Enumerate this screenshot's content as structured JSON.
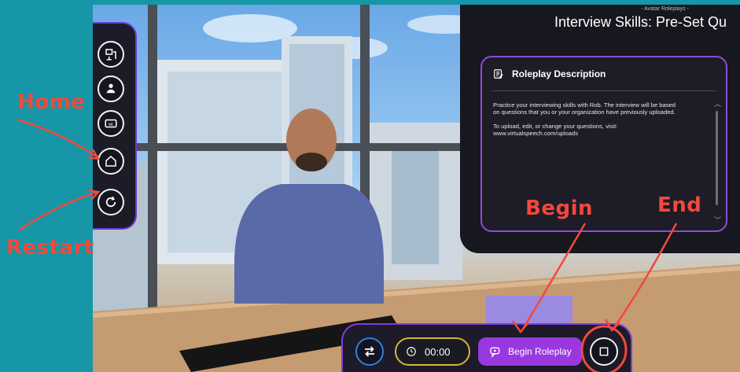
{
  "sidebar": {
    "buttons": [
      {
        "name": "presenter-mode-icon"
      },
      {
        "name": "avatar-icon"
      },
      {
        "name": "closed-captions-icon",
        "text": "cc"
      },
      {
        "name": "home-icon"
      },
      {
        "name": "restart-icon"
      }
    ]
  },
  "annotations": {
    "home": "Home",
    "restart": "Restart",
    "begin": "Begin",
    "end": "End",
    "color": "#f2483d"
  },
  "panel": {
    "kicker": "- Avatar Roleplays -",
    "title": "Interview Skills: Pre-Set Qu",
    "description_heading": "Roleplay Description",
    "description_paragraphs": [
      "Practice your interviewing skills with Rob. The interview will be based on questions that you or your organization have previously uploaded.",
      "To upload, edit, or change your questions, visit: www.virtualspeech.com/uploads"
    ]
  },
  "bottom_bar": {
    "timer": "00:00",
    "begin_label": "Begin Roleplay",
    "colors": {
      "accent": "#9a38e0",
      "timer_border": "#d7b43a",
      "swap_border": "#2f7fe0"
    }
  },
  "icons": [
    "swap-icon",
    "clock-icon",
    "chat-icon",
    "stop-icon",
    "edit-note-icon"
  ]
}
